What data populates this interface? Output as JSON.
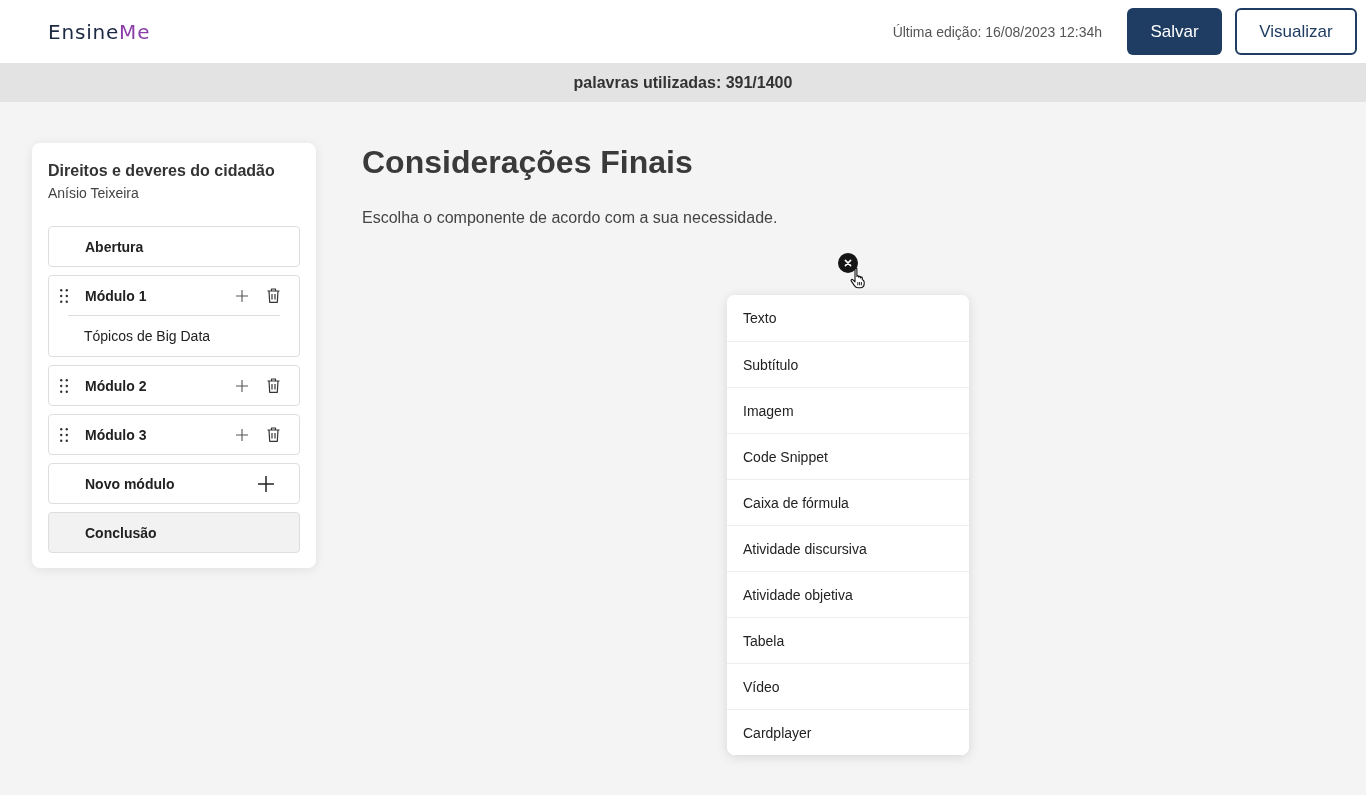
{
  "header": {
    "logo": {
      "text": "Ensine",
      "accent": "Me"
    },
    "last_edit": "Última edição: 16/08/2023 12:34h",
    "buttons": [
      {
        "label": "Salvar",
        "kind": "primary"
      },
      {
        "label": "Visualizar",
        "kind": "secondary"
      }
    ]
  },
  "word_count": "palavras utilizadas: 391/1400",
  "sidebar": {
    "title": "Direitos e deveres do cidadão",
    "author": "Anísio Teixeira",
    "items": [
      {
        "kind": "section",
        "label": "Abertura",
        "selected": false
      },
      {
        "kind": "module",
        "label": "Módulo 1",
        "selected": false,
        "expanded": true,
        "children": [
          {
            "label": "Tópicos de Big Data"
          }
        ]
      },
      {
        "kind": "module",
        "label": "Módulo 2",
        "selected": false,
        "expanded": false
      },
      {
        "kind": "module",
        "label": "Módulo 3",
        "selected": false,
        "expanded": false
      },
      {
        "kind": "add",
        "label": "Novo módulo",
        "selected": false
      },
      {
        "kind": "section",
        "label": "Conclusão",
        "selected": true
      }
    ]
  },
  "content": {
    "title": "Considerações Finais",
    "instruction": "Escolha o componente de acordo com a sua necessidade."
  },
  "component_menu": {
    "items": [
      "Texto",
      "Subtítulo",
      "Imagem",
      "Code Snippet",
      "Caixa de fórmula",
      "Atividade discursiva",
      "Atividade objetiva",
      "Tabela",
      "Vídeo",
      "Cardplayer"
    ]
  }
}
